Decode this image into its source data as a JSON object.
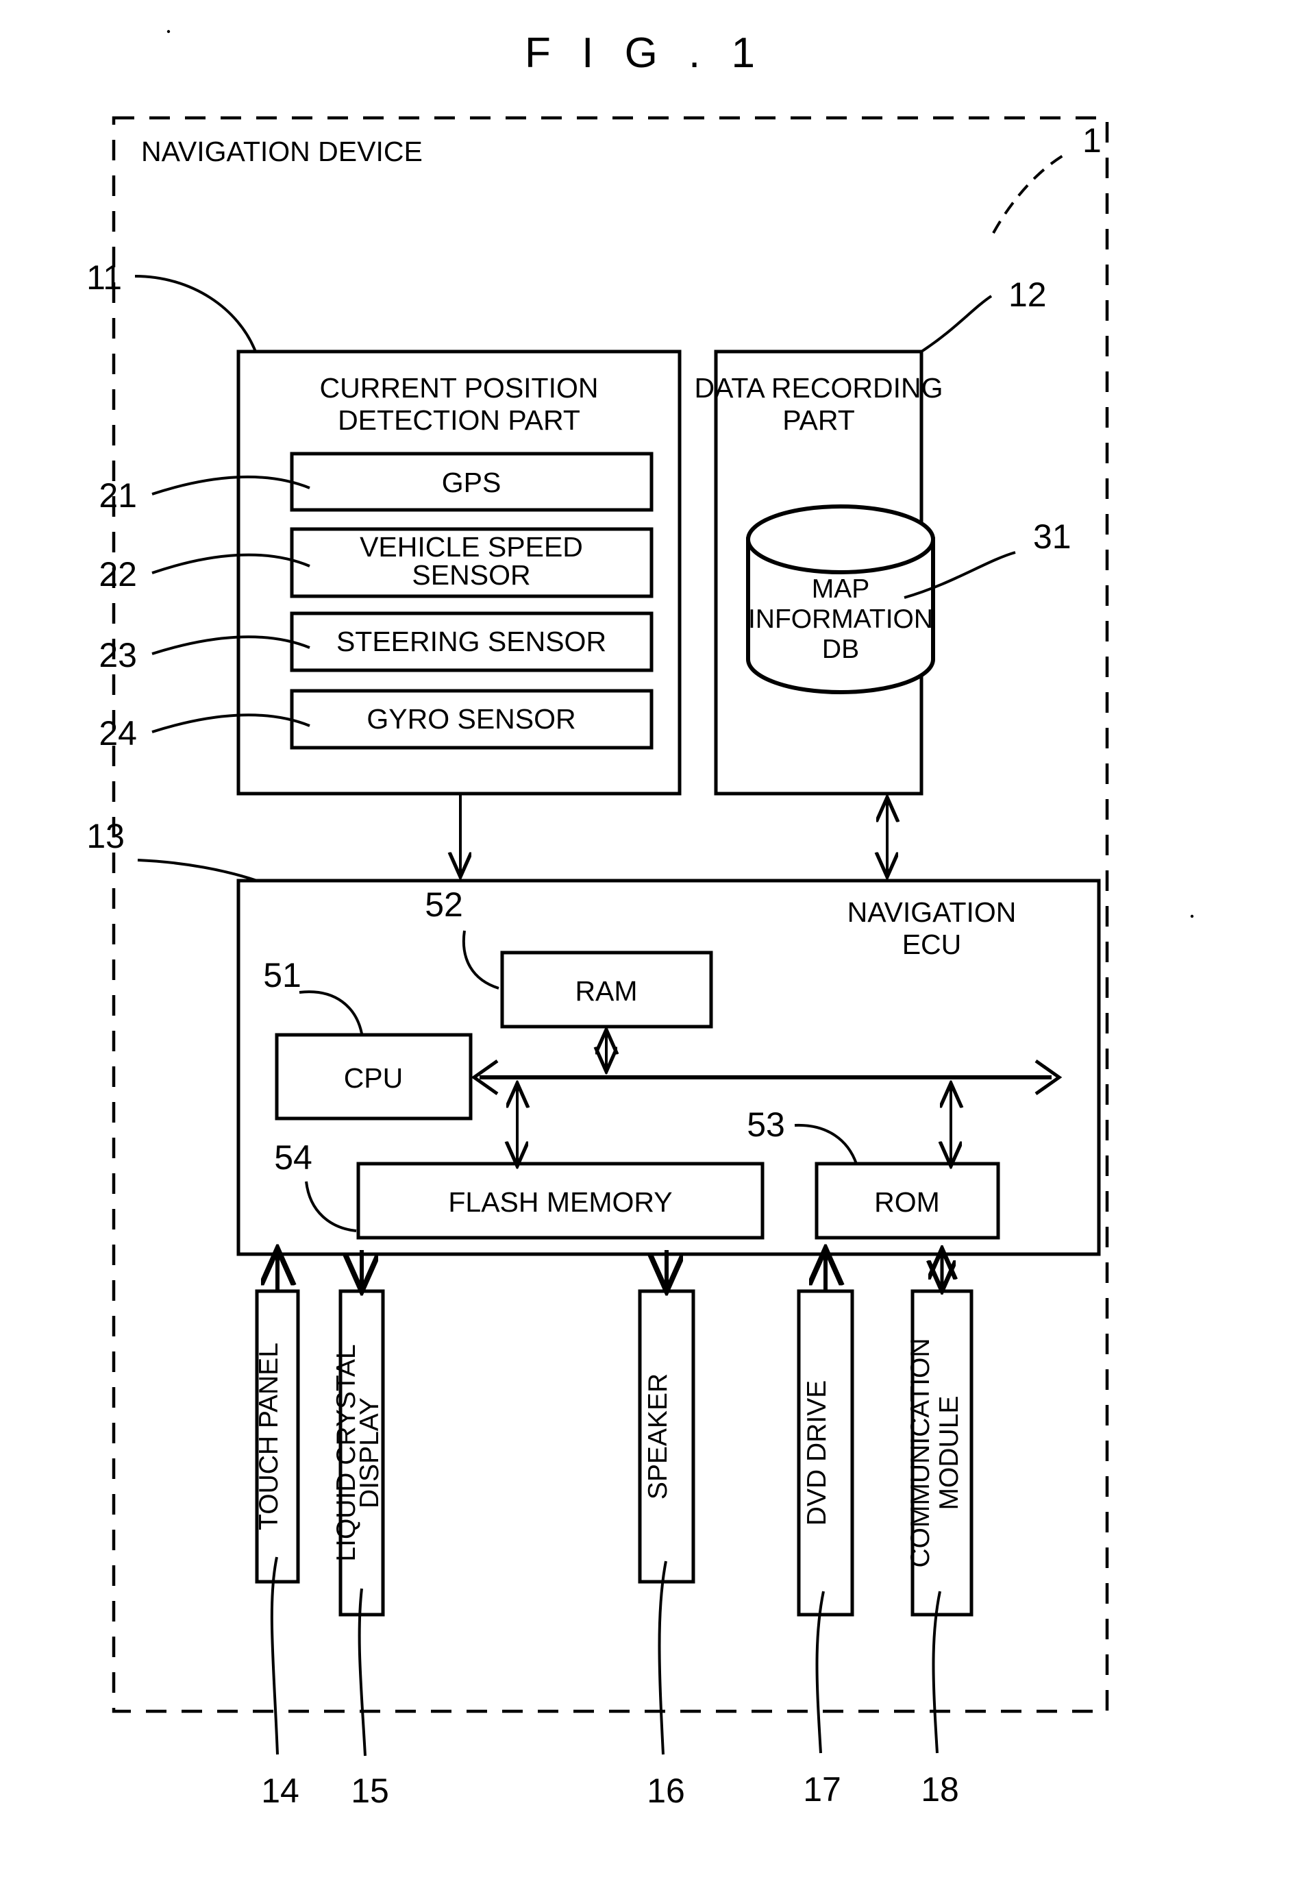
{
  "figure": {
    "title": "F I G . 1",
    "outer_label": "NAVIGATION DEVICE",
    "outer_ref": "1"
  },
  "refs": {
    "outer": "1",
    "current_position_detection_part": "11",
    "data_recording_part": "12",
    "navigation_ecu": "13",
    "touch_panel": "14",
    "liquid_crystal_display": "15",
    "speaker": "16",
    "dvd_drive": "17",
    "communication_module": "18",
    "gps": "21",
    "vehicle_speed_sensor": "22",
    "steering_sensor": "23",
    "gyro_sensor": "24",
    "map_information_db": "31",
    "cpu": "51",
    "ram": "52",
    "rom": "53",
    "flash_memory": "54"
  },
  "blocks": {
    "current_position_detection_part": {
      "title_line1": "CURRENT POSITION",
      "title_line2": "DETECTION PART",
      "sensors": [
        {
          "label": "GPS",
          "ref": "21"
        },
        {
          "label_line1": "VEHICLE SPEED",
          "label_line2": "SENSOR",
          "ref": "22"
        },
        {
          "label": "STEERING SENSOR",
          "ref": "23"
        },
        {
          "label": "GYRO SENSOR",
          "ref": "24"
        }
      ]
    },
    "data_recording_part": {
      "title_line1": "DATA RECORDING",
      "title_line2": "PART",
      "db": {
        "line1": "MAP",
        "line2": "INFORMATION",
        "line3": "DB",
        "ref": "31"
      }
    },
    "navigation_ecu": {
      "title_line1": "NAVIGATION",
      "title_line2": "ECU",
      "components": [
        {
          "label": "RAM",
          "ref": "52"
        },
        {
          "label": "CPU",
          "ref": "51"
        },
        {
          "label": "FLASH MEMORY",
          "ref": "54"
        },
        {
          "label": "ROM",
          "ref": "53"
        }
      ]
    },
    "peripherals": [
      {
        "label": "TOUCH PANEL",
        "ref": "14"
      },
      {
        "label_line1": "LIQUID CRYSTAL",
        "label_line2": "DISPLAY",
        "ref": "15"
      },
      {
        "label": "SPEAKER",
        "ref": "16"
      },
      {
        "label": "DVD DRIVE",
        "ref": "17"
      },
      {
        "label_line1": "COMMUNICATION",
        "label_line2": "MODULE",
        "ref": "18"
      }
    ]
  },
  "colors": {
    "ink": "#000000",
    "paper": "#ffffff"
  }
}
